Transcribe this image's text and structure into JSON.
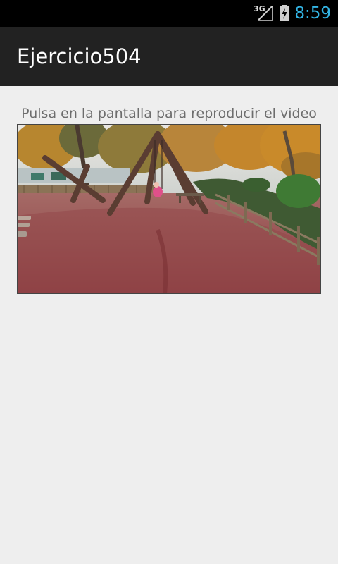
{
  "status_bar": {
    "network": "3G",
    "time": "8:59"
  },
  "action_bar": {
    "title": "Ejercicio504"
  },
  "main": {
    "instruction": "Pulsa en la pantalla para reproducir el video"
  },
  "icons": {
    "signal": "signal-strength-icon",
    "battery": "battery-charging-icon"
  },
  "colors": {
    "status_bar": "#000000",
    "action_bar": "#222222",
    "background": "#eeeeee",
    "clock": "#33b5e5"
  }
}
